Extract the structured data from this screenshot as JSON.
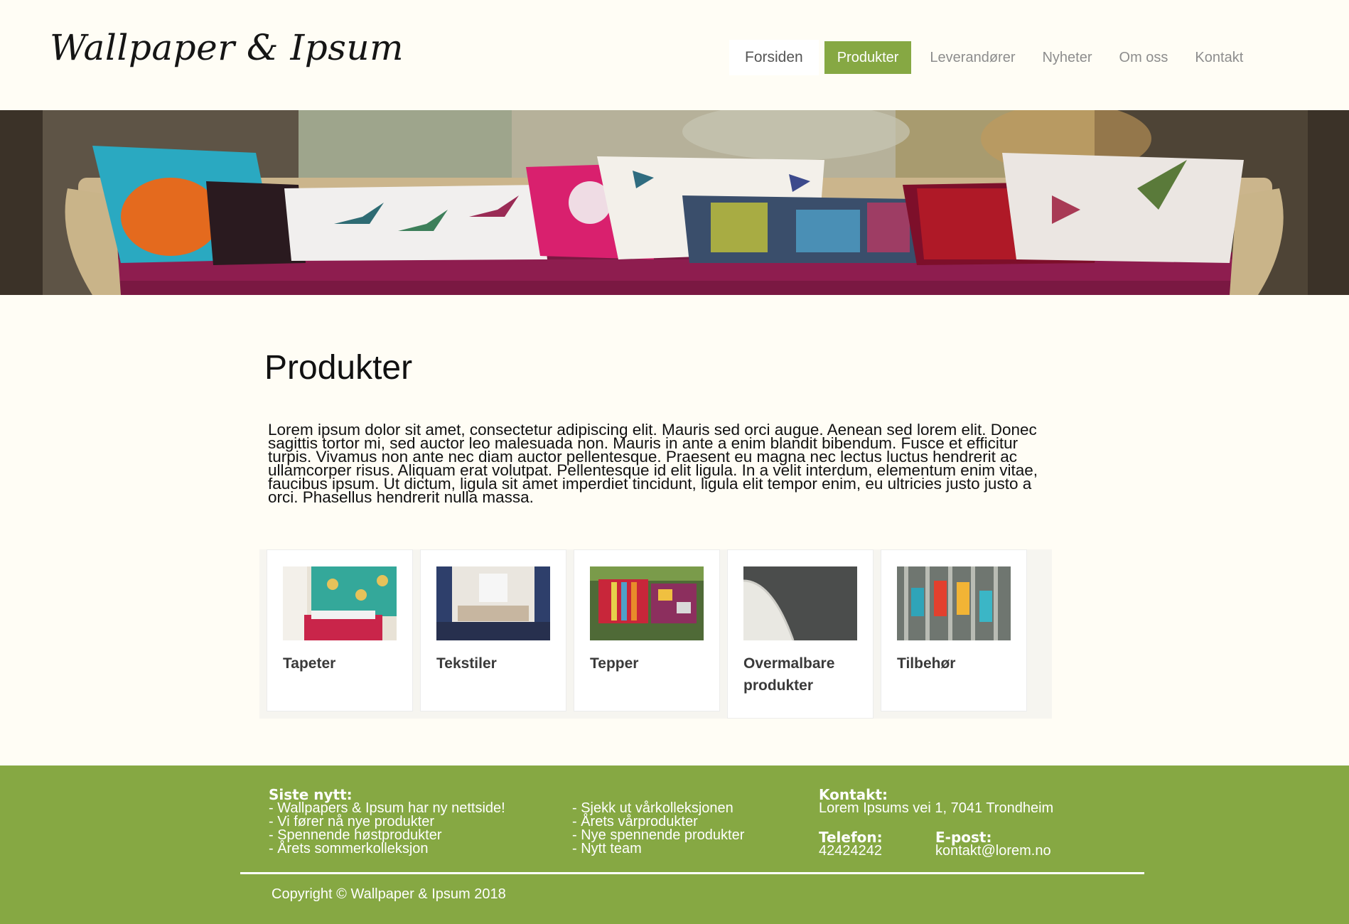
{
  "header": {
    "logo_text": "Wallpaper & Ipsum",
    "nav": [
      {
        "label": "Forsiden"
      },
      {
        "label": "Produkter"
      },
      {
        "label": "Leverandører"
      },
      {
        "label": "Nyheter"
      },
      {
        "label": "Om oss"
      },
      {
        "label": "Kontakt"
      }
    ],
    "active_nav": "Produkter"
  },
  "main": {
    "title": "Produkter",
    "intro": "Lorem ipsum dolor sit amet, consectetur adipiscing elit. Mauris sed orci augue. Aenean sed lorem elit. Donec sagittis tortor mi, sed auctor leo malesuada non. Mauris in ante a enim blandit bibendum. Fusce et efficitur turpis. Vivamus non ante nec diam auctor pellentesque. Praesent eu magna nec lectus luctus hendrerit ac ullamcorper risus. Aliquam erat volutpat. Pellentesque id elit ligula. In a velit interdum, elementum enim vitae, faucibus ipsum. Ut dictum, ligula sit amet imperdiet tincidunt, ligula elit tempor enim, eu ultricies justo justo a orci. Phasellus hendrerit nulla massa.",
    "products": [
      {
        "label": "Tapeter"
      },
      {
        "label": "Tekstiler"
      },
      {
        "label": "Tepper"
      },
      {
        "label": "Overmalbare produkter"
      },
      {
        "label": "Tilbehør"
      }
    ]
  },
  "footer": {
    "news_heading": "Siste nytt:",
    "news_col1": [
      "- Wallpapers & Ipsum har ny nettside!",
      "- Vi fører nå nye produkter",
      "- Spennende høstprodukter",
      "- Årets sommerkolleksjon"
    ],
    "news_col2": [
      "- Sjekk ut vårkolleksjonen",
      "- Årets vårprodukter",
      "- Nye spennende produkter",
      "- Nytt team"
    ],
    "contact_heading": "Kontakt:",
    "address": "Lorem Ipsums vei 1, 7041 Trondheim",
    "phone_heading": "Telefon:",
    "phone": "42424242",
    "email_heading": "E-post:",
    "email": "kontakt@lorem.no",
    "copyright": "Copyright © Wallpaper & Ipsum 2018"
  },
  "colors": {
    "background": "#fffdf5",
    "accent": "#86a843",
    "nav_text": "#8d8d8d"
  }
}
